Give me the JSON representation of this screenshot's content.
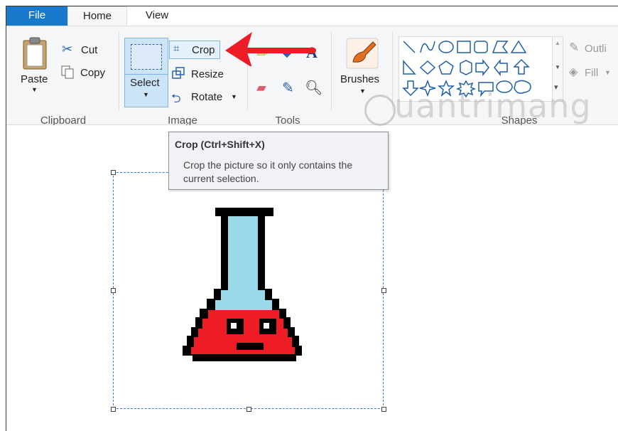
{
  "tabs": {
    "file": "File",
    "home": "Home",
    "view": "View"
  },
  "clipboard": {
    "paste": "Paste",
    "cut": "Cut",
    "copy": "Copy",
    "label": "Clipboard"
  },
  "image": {
    "select": "Select",
    "crop": "Crop",
    "resize": "Resize",
    "rotate": "Rotate",
    "label": "Image"
  },
  "tools": {
    "label": "Tools"
  },
  "brushes": {
    "label": "Brushes"
  },
  "shapes": {
    "label": "Shapes",
    "outline": "Outli",
    "fill": "Fill"
  },
  "tooltip": {
    "title": "Crop (Ctrl+Shift+X)",
    "body": "Crop the picture so it only contains the current selection."
  },
  "watermark": "uantrimang",
  "colors": {
    "file_tab": "#1979ca",
    "selection": "#2b7fd6",
    "flask_red": "#ee1c24",
    "flask_blue": "#99d9ea",
    "arrow": "#ee1c24"
  }
}
